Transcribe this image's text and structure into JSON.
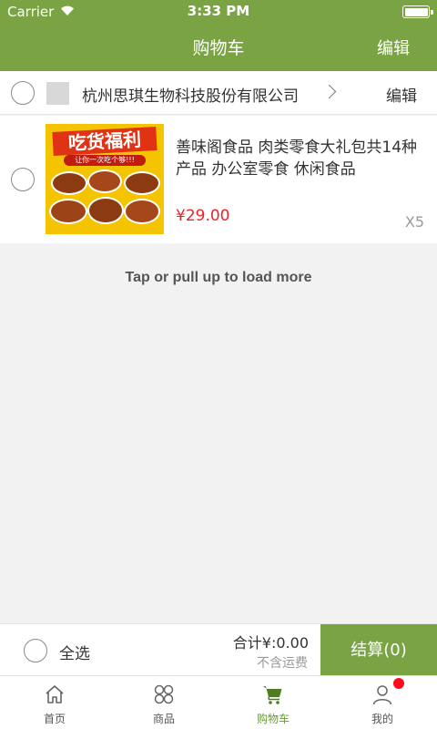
{
  "status_bar": {
    "carrier": "Carrier",
    "time": "3:33 PM"
  },
  "nav": {
    "title": "购物车",
    "edit": "编辑"
  },
  "shop": {
    "name": "杭州思琪生物科技股份有限公司",
    "edit": "编辑"
  },
  "item": {
    "image_text": {
      "banner": "吃货福利",
      "subline": "让你一次吃个够!!!"
    },
    "title": "善味阁食品 肉类零食大礼包共14种产品 办公室零食 休闲食品",
    "price": "¥29.00",
    "quantity": "X5"
  },
  "load_more": "Tap or pull up to load more",
  "checkout": {
    "select_all": "全选",
    "total": "合计¥:0.00",
    "shipping_note": "不含运费",
    "pay_button": "结算(0)"
  },
  "tabs": [
    {
      "label": "首页",
      "icon": "home-icon"
    },
    {
      "label": "商品",
      "icon": "grid-icon"
    },
    {
      "label": "购物车",
      "icon": "cart-icon",
      "active": true
    },
    {
      "label": "我的",
      "icon": "user-icon"
    }
  ],
  "colors": {
    "accent": "#7aa443",
    "price": "#e8262a",
    "badge": "#ff0a1e"
  }
}
